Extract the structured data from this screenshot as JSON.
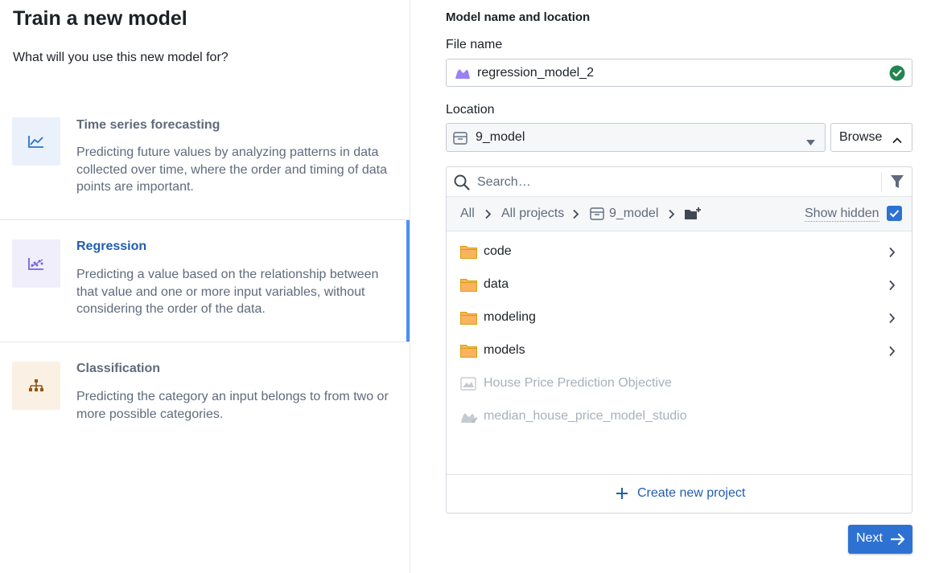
{
  "left": {
    "title": "Train a new model",
    "question": "What will you use this new model for?",
    "options": [
      {
        "title": "Time series forecasting",
        "description": "Predicting future values by analyzing patterns in data collected over time, where the order and timing of data points are important.",
        "icon": "line-chart-icon",
        "icon_bg": "#eaf1fb",
        "icon_color": "#2d72d2",
        "selected": false
      },
      {
        "title": "Regression",
        "description": "Predicting a value based on the relationship between that value and one or more input variables, without considering the order of the data.",
        "icon": "scatter-plot-icon",
        "icon_bg": "#f0eefa",
        "icon_color": "#7961db",
        "selected": true
      },
      {
        "title": "Classification",
        "description": "Predicting the category an input belongs to from two or more possible categories.",
        "icon": "hierarchy-icon",
        "icon_bg": "#fbf0e4",
        "icon_color": "#935610",
        "selected": false
      }
    ]
  },
  "right": {
    "section_title": "Model name and location",
    "file_name_label": "File name",
    "file_name_value": "regression_model_2",
    "location_label": "Location",
    "location_value": "9_model",
    "browse_label": "Browse",
    "search_placeholder": "Search…",
    "breadcrumb": [
      "All",
      "All projects",
      "9_model"
    ],
    "show_hidden_label": "Show hidden",
    "show_hidden_checked": true,
    "items": [
      {
        "label": "code",
        "type": "folder",
        "disabled": false
      },
      {
        "label": "data",
        "type": "folder",
        "disabled": false
      },
      {
        "label": "modeling",
        "type": "folder",
        "disabled": false
      },
      {
        "label": "models",
        "type": "folder",
        "disabled": false
      },
      {
        "label": "House Price Prediction Objective",
        "type": "objective",
        "disabled": true
      },
      {
        "label": "median_house_price_model_studio",
        "type": "model",
        "disabled": true
      }
    ],
    "create_project_label": "Create new project",
    "next_label": "Next"
  },
  "colors": {
    "accent": "#2d72d2",
    "selected_bar": "#4c90f0",
    "success": "#238551",
    "folder": "#fbb360"
  }
}
